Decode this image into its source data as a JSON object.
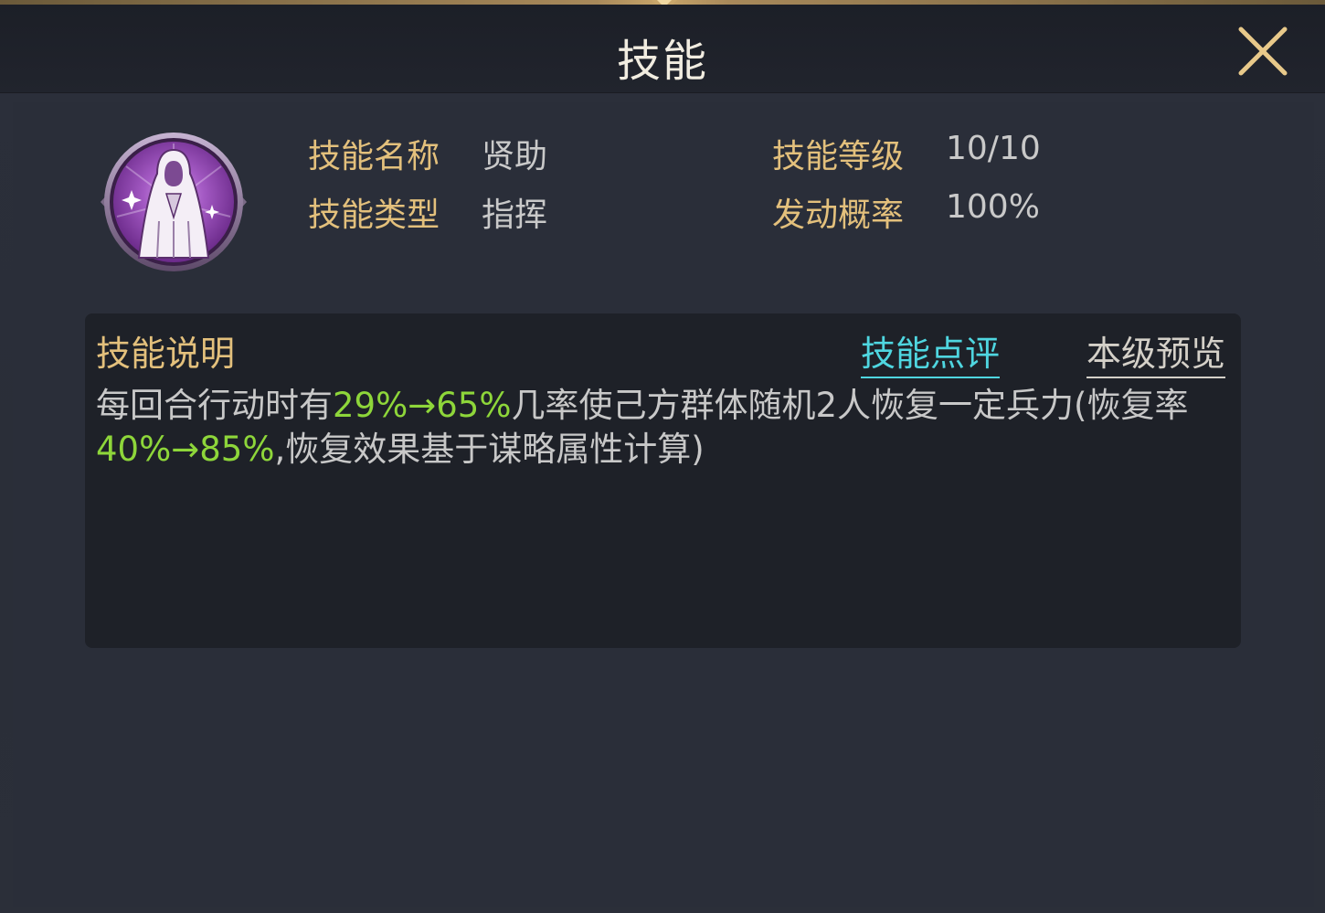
{
  "window": {
    "title": "技能"
  },
  "skill": {
    "icon": "praying-figure-icon",
    "name_label": "技能名称",
    "name_value": "贤助",
    "type_label": "技能类型",
    "type_value": "指挥",
    "level_label": "技能等级",
    "level_value": "10/10",
    "chance_label": "发动概率",
    "chance_value": "100%"
  },
  "description": {
    "title": "技能说明",
    "tabs": {
      "review": "技能点评",
      "preview": "本级预览"
    },
    "segments": [
      {
        "text": "每回合行动时有",
        "highlight": false
      },
      {
        "text": "29%→65%",
        "highlight": true
      },
      {
        "text": "几率使己方群体随机2人恢复一定兵力(恢复率",
        "highlight": false
      },
      {
        "text": "40%→85%",
        "highlight": true
      },
      {
        "text": ",恢复效果基于谋略属性计算)",
        "highlight": false
      }
    ]
  },
  "colors": {
    "label": "#e3c07c",
    "value": "#c9c9c9",
    "highlight": "#8ed63a",
    "active_tab": "#4fd6e0",
    "icon_purple": "#9a4fb8"
  }
}
